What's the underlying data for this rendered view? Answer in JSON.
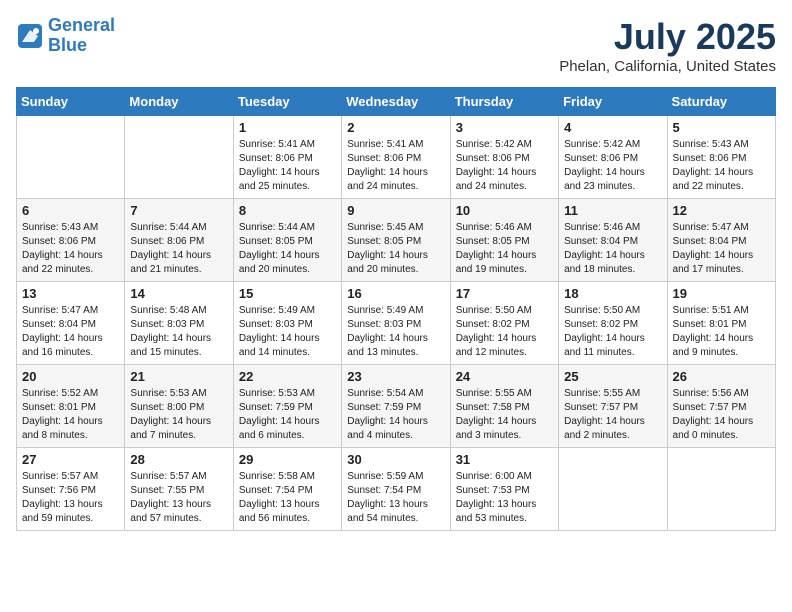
{
  "header": {
    "logo_line1": "General",
    "logo_line2": "Blue",
    "month": "July 2025",
    "location": "Phelan, California, United States"
  },
  "weekdays": [
    "Sunday",
    "Monday",
    "Tuesday",
    "Wednesday",
    "Thursday",
    "Friday",
    "Saturday"
  ],
  "weeks": [
    [
      {
        "day": "",
        "text": ""
      },
      {
        "day": "",
        "text": ""
      },
      {
        "day": "1",
        "text": "Sunrise: 5:41 AM\nSunset: 8:06 PM\nDaylight: 14 hours and 25 minutes."
      },
      {
        "day": "2",
        "text": "Sunrise: 5:41 AM\nSunset: 8:06 PM\nDaylight: 14 hours and 24 minutes."
      },
      {
        "day": "3",
        "text": "Sunrise: 5:42 AM\nSunset: 8:06 PM\nDaylight: 14 hours and 24 minutes."
      },
      {
        "day": "4",
        "text": "Sunrise: 5:42 AM\nSunset: 8:06 PM\nDaylight: 14 hours and 23 minutes."
      },
      {
        "day": "5",
        "text": "Sunrise: 5:43 AM\nSunset: 8:06 PM\nDaylight: 14 hours and 22 minutes."
      }
    ],
    [
      {
        "day": "6",
        "text": "Sunrise: 5:43 AM\nSunset: 8:06 PM\nDaylight: 14 hours and 22 minutes."
      },
      {
        "day": "7",
        "text": "Sunrise: 5:44 AM\nSunset: 8:06 PM\nDaylight: 14 hours and 21 minutes."
      },
      {
        "day": "8",
        "text": "Sunrise: 5:44 AM\nSunset: 8:05 PM\nDaylight: 14 hours and 20 minutes."
      },
      {
        "day": "9",
        "text": "Sunrise: 5:45 AM\nSunset: 8:05 PM\nDaylight: 14 hours and 20 minutes."
      },
      {
        "day": "10",
        "text": "Sunrise: 5:46 AM\nSunset: 8:05 PM\nDaylight: 14 hours and 19 minutes."
      },
      {
        "day": "11",
        "text": "Sunrise: 5:46 AM\nSunset: 8:04 PM\nDaylight: 14 hours and 18 minutes."
      },
      {
        "day": "12",
        "text": "Sunrise: 5:47 AM\nSunset: 8:04 PM\nDaylight: 14 hours and 17 minutes."
      }
    ],
    [
      {
        "day": "13",
        "text": "Sunrise: 5:47 AM\nSunset: 8:04 PM\nDaylight: 14 hours and 16 minutes."
      },
      {
        "day": "14",
        "text": "Sunrise: 5:48 AM\nSunset: 8:03 PM\nDaylight: 14 hours and 15 minutes."
      },
      {
        "day": "15",
        "text": "Sunrise: 5:49 AM\nSunset: 8:03 PM\nDaylight: 14 hours and 14 minutes."
      },
      {
        "day": "16",
        "text": "Sunrise: 5:49 AM\nSunset: 8:03 PM\nDaylight: 14 hours and 13 minutes."
      },
      {
        "day": "17",
        "text": "Sunrise: 5:50 AM\nSunset: 8:02 PM\nDaylight: 14 hours and 12 minutes."
      },
      {
        "day": "18",
        "text": "Sunrise: 5:50 AM\nSunset: 8:02 PM\nDaylight: 14 hours and 11 minutes."
      },
      {
        "day": "19",
        "text": "Sunrise: 5:51 AM\nSunset: 8:01 PM\nDaylight: 14 hours and 9 minutes."
      }
    ],
    [
      {
        "day": "20",
        "text": "Sunrise: 5:52 AM\nSunset: 8:01 PM\nDaylight: 14 hours and 8 minutes."
      },
      {
        "day": "21",
        "text": "Sunrise: 5:53 AM\nSunset: 8:00 PM\nDaylight: 14 hours and 7 minutes."
      },
      {
        "day": "22",
        "text": "Sunrise: 5:53 AM\nSunset: 7:59 PM\nDaylight: 14 hours and 6 minutes."
      },
      {
        "day": "23",
        "text": "Sunrise: 5:54 AM\nSunset: 7:59 PM\nDaylight: 14 hours and 4 minutes."
      },
      {
        "day": "24",
        "text": "Sunrise: 5:55 AM\nSunset: 7:58 PM\nDaylight: 14 hours and 3 minutes."
      },
      {
        "day": "25",
        "text": "Sunrise: 5:55 AM\nSunset: 7:57 PM\nDaylight: 14 hours and 2 minutes."
      },
      {
        "day": "26",
        "text": "Sunrise: 5:56 AM\nSunset: 7:57 PM\nDaylight: 14 hours and 0 minutes."
      }
    ],
    [
      {
        "day": "27",
        "text": "Sunrise: 5:57 AM\nSunset: 7:56 PM\nDaylight: 13 hours and 59 minutes."
      },
      {
        "day": "28",
        "text": "Sunrise: 5:57 AM\nSunset: 7:55 PM\nDaylight: 13 hours and 57 minutes."
      },
      {
        "day": "29",
        "text": "Sunrise: 5:58 AM\nSunset: 7:54 PM\nDaylight: 13 hours and 56 minutes."
      },
      {
        "day": "30",
        "text": "Sunrise: 5:59 AM\nSunset: 7:54 PM\nDaylight: 13 hours and 54 minutes."
      },
      {
        "day": "31",
        "text": "Sunrise: 6:00 AM\nSunset: 7:53 PM\nDaylight: 13 hours and 53 minutes."
      },
      {
        "day": "",
        "text": ""
      },
      {
        "day": "",
        "text": ""
      }
    ]
  ]
}
